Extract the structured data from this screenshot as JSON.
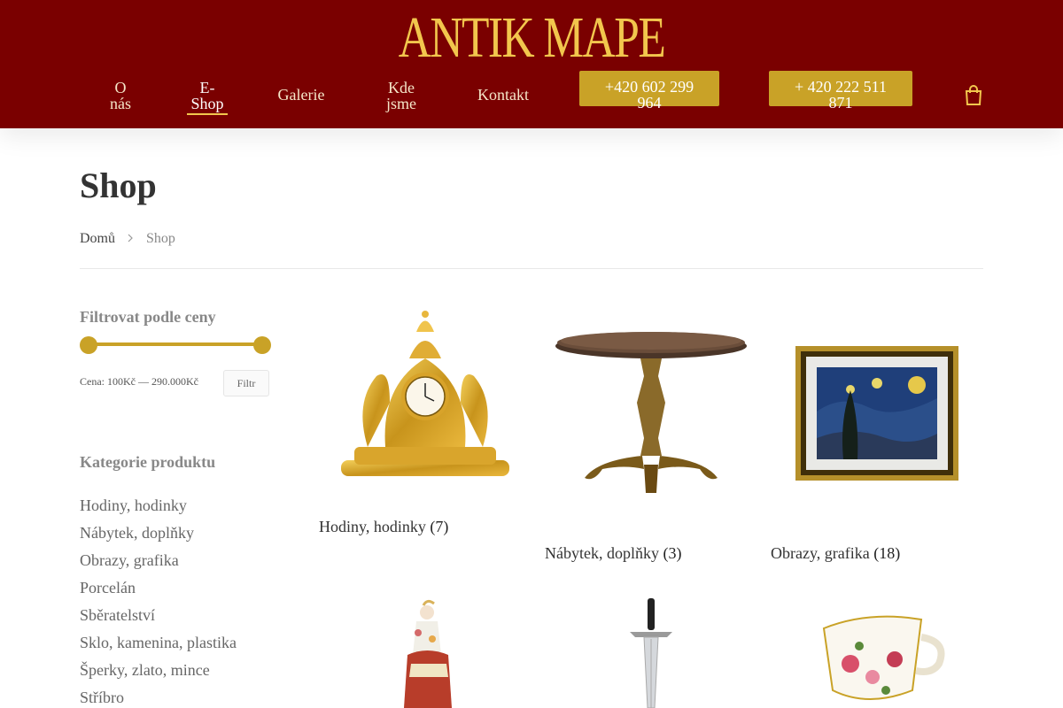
{
  "brand": {
    "logo_text": "ANTIK MAPE"
  },
  "nav": {
    "items": [
      {
        "label": "O nás"
      },
      {
        "label": "E-Shop"
      },
      {
        "label": "Galerie"
      },
      {
        "label": "Kde jsme"
      },
      {
        "label": "Kontakt"
      }
    ],
    "active": "E-Shop",
    "phones": [
      "+420 602 299 964",
      "+ 420 222 511 871"
    ]
  },
  "page": {
    "title": "Shop",
    "breadcrumb": [
      "Domů",
      "Shop"
    ]
  },
  "sidebar": {
    "price_filter": {
      "heading": "Filtrovat podle ceny",
      "price_text": "Cena: 100Kč — 290.000Kč",
      "button_label": "Filtr"
    },
    "categories": {
      "heading": "Kategorie produktu",
      "items": [
        "Hodiny, hodinky",
        "Nábytek, doplňky",
        "Obrazy, grafika",
        "Porcelán",
        "Sběratelství",
        "Sklo, kamenina, plastika",
        "Šperky, zlato, mince",
        "Stříbro"
      ]
    }
  },
  "products": [
    {
      "name": "Hodiny, hodinky",
      "count": "(7)",
      "icon": "gilded-mantel-clock"
    },
    {
      "name": "Nábytek, doplňky",
      "count": "(3)",
      "icon": "round-wooden-table"
    },
    {
      "name": "Obrazy, grafika",
      "count": "(18)",
      "icon": "framed-painting"
    },
    {
      "name": "",
      "count": "",
      "icon": "porcelain-figurine"
    },
    {
      "name": "",
      "count": "",
      "icon": "sword"
    },
    {
      "name": "",
      "count": "",
      "icon": "floral-teacup"
    }
  ],
  "colors": {
    "header_bg": "#7a0000",
    "gold": "#c9a227",
    "logo": "#f2c64d"
  }
}
